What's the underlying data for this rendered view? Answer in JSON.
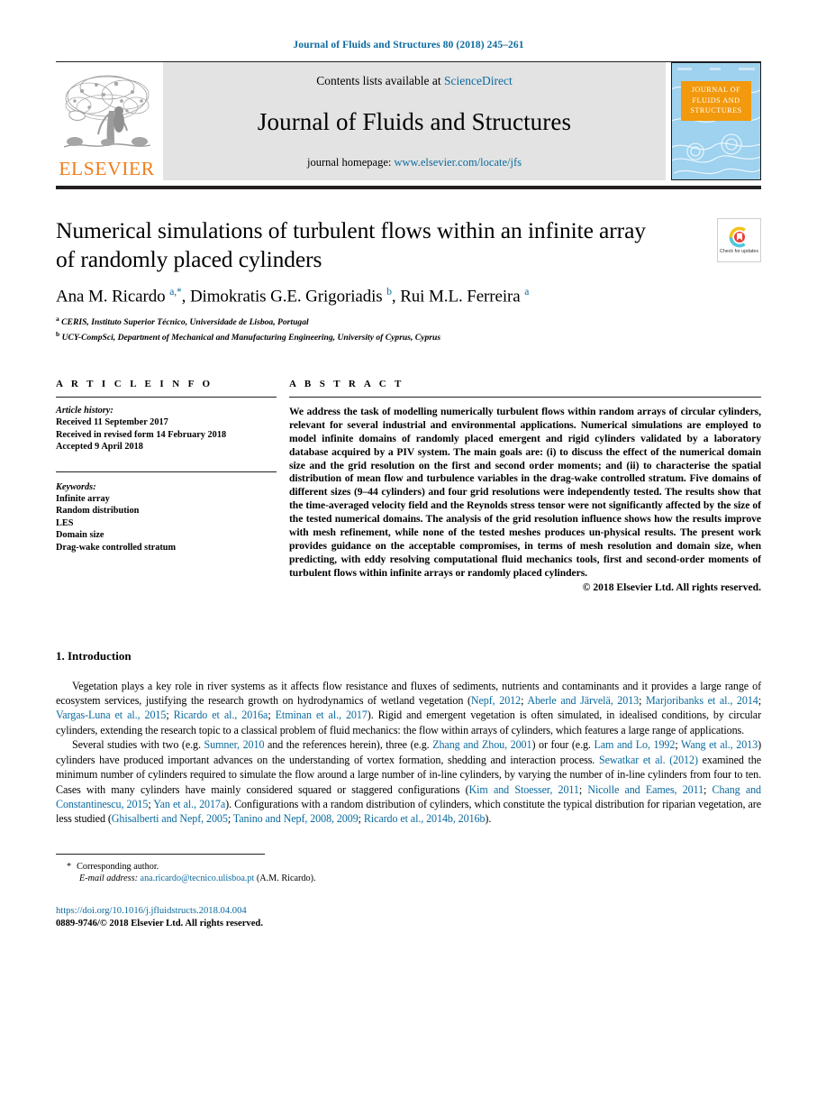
{
  "running_head": "Journal of Fluids and Structures 80 (2018) 245–261",
  "masthead": {
    "publisher_wordmark": "ELSEVIER",
    "contents_prefix": "Contents lists available at ",
    "contents_link": "ScienceDirect",
    "journal_title": "Journal of Fluids and Structures",
    "homepage_prefix": "journal homepage: ",
    "homepage_link": "www.elsevier.com/locate/jfs",
    "cover_title": "JOURNAL OF FLUIDS AND STRUCTURES"
  },
  "article": {
    "title": "Numerical simulations of turbulent flows within an infinite array of randomly placed cylinders",
    "authors_html": "Ana M. Ricardo <sup>a,*</sup>, Dimokratis G.E. Grigoriadis <sup>b</sup>, Rui M.L. Ferreira <sup>a</sup>",
    "affiliations": [
      {
        "marker": "a",
        "text": "CERIS, Instituto Superior Técnico, Universidade de Lisboa, Portugal"
      },
      {
        "marker": "b",
        "text": "UCY-CompSci, Department of Mechanical and Manufacturing Engineering, University of Cyprus, Cyprus"
      }
    ],
    "crossmark_caption": "Check for updates"
  },
  "article_info": {
    "heading": "A R T I C L E   I N F O",
    "history_label": "Article history:",
    "history": [
      "Received 11 September 2017",
      "Received in revised form 14 February 2018",
      "Accepted 9 April 2018"
    ],
    "keywords_label": "Keywords:",
    "keywords": [
      "Infinite array",
      "Random distribution",
      "LES",
      "Domain size",
      "Drag-wake controlled stratum"
    ]
  },
  "abstract": {
    "heading": "A B S T R A C T",
    "text": "We address the task of modelling numerically turbulent flows within random arrays of circular cylinders, relevant for several industrial and environmental applications. Numerical simulations are employed to model infinite domains of randomly placed emergent and rigid cylinders validated by a laboratory database acquired by a PIV system. The main goals are: (i) to discuss the effect of the numerical domain size and the grid resolution on the first and second order moments; and (ii) to characterise the spatial distribution of mean flow and turbulence variables in the drag-wake controlled stratum. Five domains of different sizes (9–44 cylinders) and four grid resolutions were independently tested. The results show that the time-averaged velocity field and the Reynolds stress tensor were not significantly affected by the size of the tested numerical domains. The analysis of the grid resolution influence shows how the results improve with mesh refinement, while none of the tested meshes produces un-physical results. The present work provides guidance on the acceptable compromises, in terms of mesh resolution and domain size, when predicting, with eddy resolving computational fluid mechanics tools, first and second-order moments of turbulent flows within infinite arrays or randomly placed cylinders.",
    "copyright": "© 2018 Elsevier Ltd. All rights reserved."
  },
  "introduction": {
    "heading": "1. Introduction",
    "paragraph1_html": "Vegetation plays a key role in river systems as it affects flow resistance and fluxes of sediments, nutrients and contaminants and it provides a large range of ecosystem services, justifying the research growth on hydrodynamics of wetland vegetation (<span class=\"link\">Nepf, 2012</span>; <span class=\"link\">Aberle and Järvelä, 2013</span>; <span class=\"link\">Marjoribanks et al., 2014</span>; <span class=\"link\">Vargas-Luna et al., 2015</span>; <span class=\"link\">Ricardo et al., 2016a</span>; <span class=\"link\">Etminan et al., 2017</span>). Rigid and emergent vegetation is often simulated, in idealised conditions, by circular cylinders, extending the research topic to a classical problem of fluid mechanics: the flow within arrays of cylinders, which features a large range of applications.",
    "paragraph2_html": "Several studies with two  (e.g. <span class=\"link\">Sumner, 2010</span> and the references herein), three  (e.g. <span class=\"link\">Zhang and Zhou, 2001</span>) or four  (e.g. <span class=\"link\">Lam and Lo, 1992</span>; <span class=\"link\">Wang et al., 2013</span>) cylinders have produced important advances on the understanding of vortex formation, shedding and interaction process. <span class=\"link\">Sewatkar et al. (2012)</span> examined the minimum number of cylinders required to simulate the flow around a large number of in-line cylinders, by varying the number of in-line cylinders from four to ten. Cases with many cylinders have mainly considered squared or staggered configurations  (<span class=\"link\">Kim and Stoesser, 2011</span>; <span class=\"link\">Nicolle and Eames, 2011</span>; <span class=\"link\">Chang and Constantinescu, 2015</span>; <span class=\"link\">Yan et al., 2017a</span>). Configurations with a random distribution of cylinders, which constitute the typical distribution for riparian vegetation, are less studied  (<span class=\"link\">Ghisalberti and Nepf, 2005</span>; <span class=\"link\">Tanino and Nepf, 2008, 2009</span>; <span class=\"link\">Ricardo et al., 2014b, 2016b</span>)."
  },
  "footer": {
    "corresponding_marker": "*",
    "corresponding_label": "Corresponding author.",
    "email_label": "E-mail address:",
    "email": "ana.ricardo@tecnico.ulisboa.pt",
    "email_owner": "(A.M. Ricardo).",
    "doi": "https://doi.org/10.1016/j.jfluidstructs.2018.04.004",
    "issn_line": "0889-9746/© 2018 Elsevier Ltd. All rights reserved."
  },
  "colors": {
    "link_blue": "#0b6a9e",
    "elsevier_orange": "#ef7d1a",
    "banner_grey": "#e3e3e3",
    "cover_blue": "#9ed2ef",
    "cover_orange": "#f2990d"
  }
}
